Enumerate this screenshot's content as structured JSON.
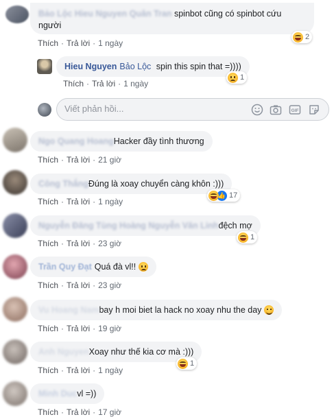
{
  "comments": [
    {
      "name": "Bảo Lộc Hieu Nguyen Quân Tran",
      "text": "spinbot cũng có spinbot cứu người",
      "actions": {
        "like": "Thích",
        "reply": "Trả lời",
        "time": "1 ngày"
      },
      "reaction_count": "2"
    },
    {
      "name": "Hieu Nguyen",
      "mention": "Bảo Lộc",
      "text": "spin this spin that =))))",
      "actions": {
        "like": "Thích",
        "reply": "Trả lời",
        "time": "1 ngày"
      },
      "reaction_count": "1"
    },
    {
      "name": "Ngo Quang Hoang",
      "text": "Hacker đầy tình thương",
      "actions": {
        "like": "Thích",
        "reply": "Trả lời",
        "time": "21 giờ"
      }
    },
    {
      "name": "Công Thắng",
      "text": "Đúng là xoay chuyển càng khôn :)))",
      "actions": {
        "like": "Thích",
        "reply": "Trả lời",
        "time": "1 ngày"
      },
      "reaction_count": "17"
    },
    {
      "name": "Nguyễn Đăng Tùng Hoàng Nguyễn Văn Linh",
      "text": "đệch mợ",
      "actions": {
        "like": "Thích",
        "reply": "Trả lời",
        "time": "23 giờ"
      },
      "reaction_count": "1"
    },
    {
      "name": "Trần Quy Đạt",
      "text": "Quá đà vl!!",
      "actions": {
        "like": "Thích",
        "reply": "Trả lời",
        "time": "23 giờ"
      }
    },
    {
      "name": "Vu Hoang Nam",
      "text": "bay h moi biet la hack no xoay nhu the day",
      "actions": {
        "like": "Thích",
        "reply": "Trả lời",
        "time": "19 giờ"
      }
    },
    {
      "name": "Anh Nguyen",
      "text": "Xoay như thế kia cơ mà :)))",
      "actions": {
        "like": "Thích",
        "reply": "Trả lời",
        "time": "1 ngày"
      },
      "reaction_count": "1"
    },
    {
      "name": "Minh Duc",
      "text": "vl =))",
      "actions": {
        "like": "Thích",
        "reply": "Trả lời",
        "time": "17 giờ"
      }
    }
  ],
  "reply_box": {
    "placeholder": "Viết phản hồi..."
  },
  "colors": {
    "author": "#385898",
    "bubble": "#f2f3f5",
    "meta": "#606770"
  }
}
